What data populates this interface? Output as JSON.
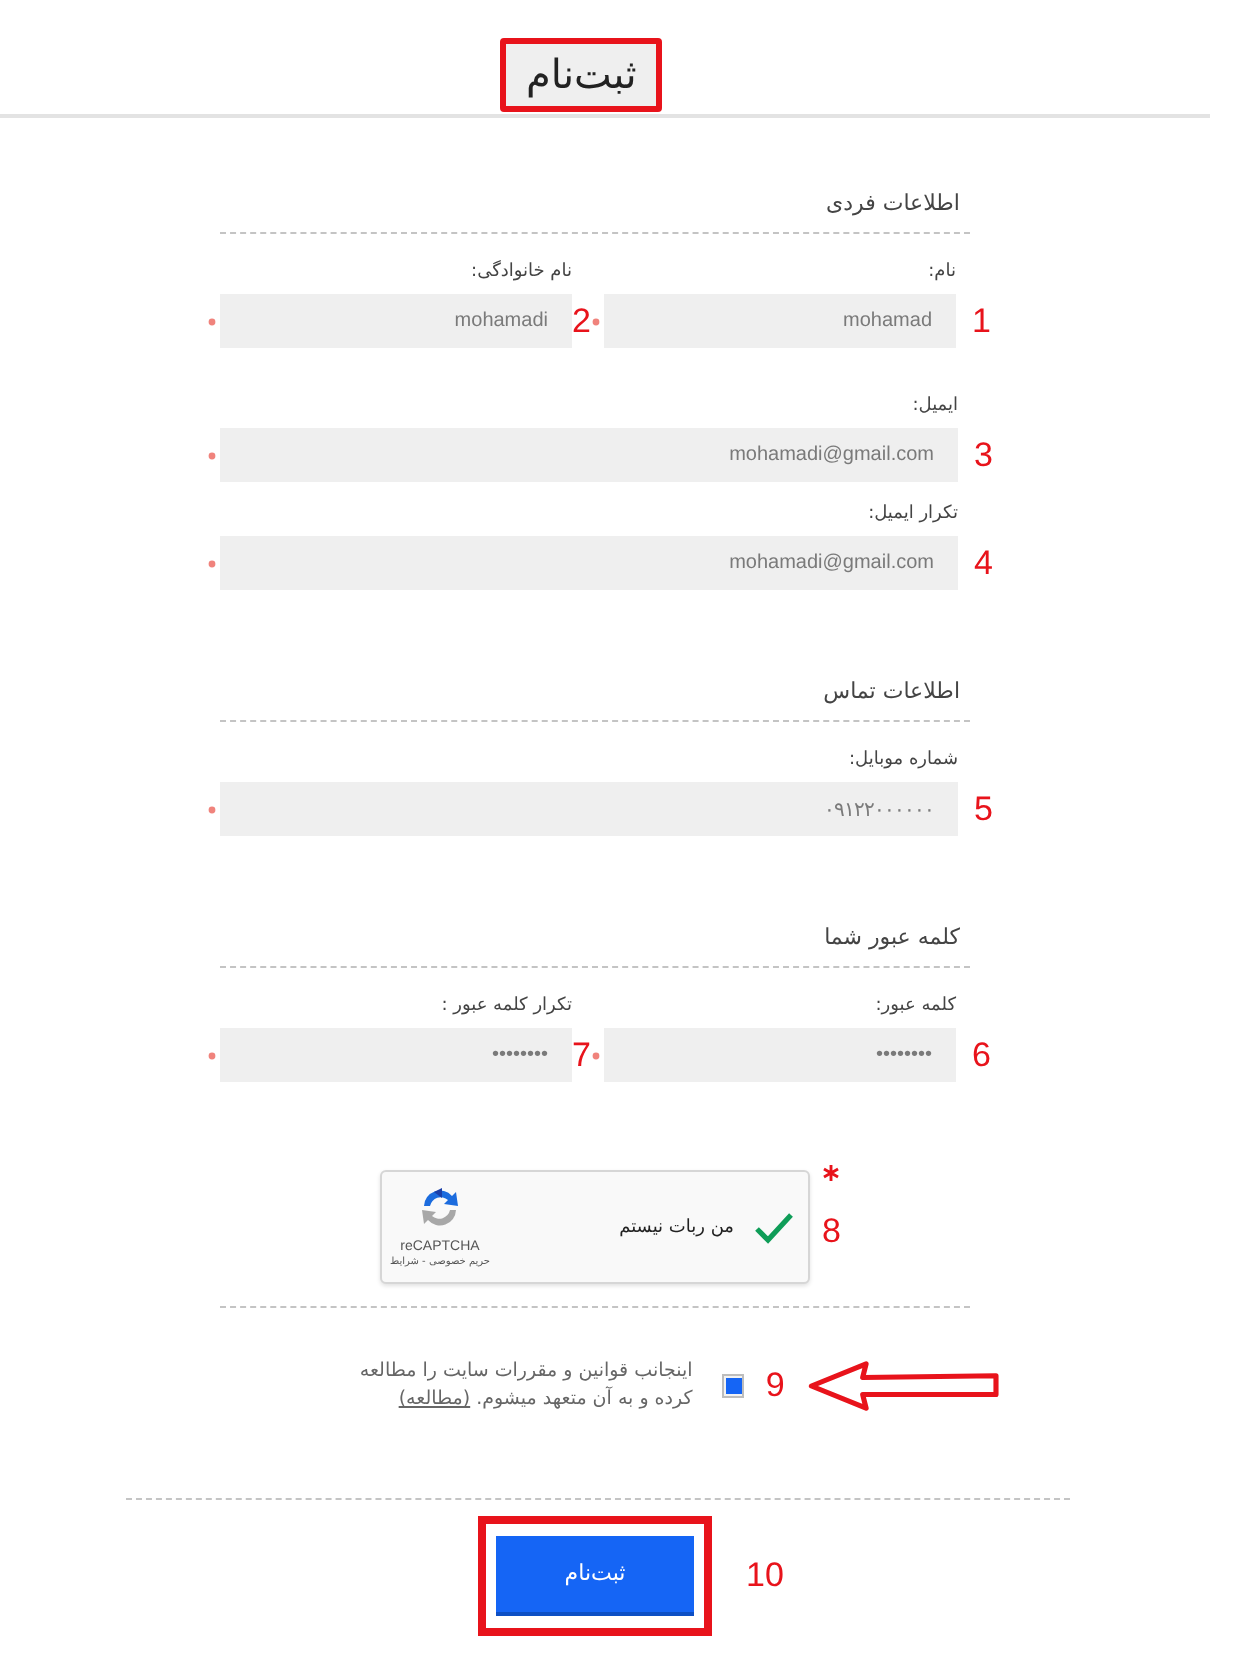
{
  "page_title": {
    "text": "ثبت‌نام",
    "highlighted": true
  },
  "sections": [
    {
      "heading": "اطلاعات فردی",
      "rows": [
        {
          "fields": [
            {
              "label": "نام:",
              "value": "mohamad",
              "required": true,
              "marker": "1"
            },
            {
              "label": "نام خانوادگی:",
              "value": "mohamadi",
              "required": true,
              "marker": "2"
            }
          ]
        },
        {
          "fields": [
            {
              "label": "ایمیل:",
              "value": "mohamadi@gmail.com",
              "required": true,
              "marker": "3"
            }
          ]
        },
        {
          "fields": [
            {
              "label": "تکرار ایمیل:",
              "value": "mohamadi@gmail.com",
              "required": true,
              "marker": "4"
            }
          ]
        }
      ]
    },
    {
      "heading": "اطلاعات تماس",
      "rows": [
        {
          "fields": [
            {
              "label": "شماره موبایل:",
              "value": "۰۹۱۲۲۰۰۰۰۰۰",
              "required": true,
              "marker": "5"
            }
          ]
        }
      ]
    },
    {
      "heading": "کلمه عبور شما",
      "rows": [
        {
          "fields": [
            {
              "label": "کلمه عبور:",
              "value": "••••••••",
              "required": true,
              "marker": "6"
            },
            {
              "label": "تکرار کلمه عبور :",
              "value": "••••••••",
              "required": true,
              "marker": "7"
            }
          ]
        }
      ]
    }
  ],
  "captcha": {
    "label": "من ربات نیستم",
    "checked": true,
    "brand": "reCAPTCHA",
    "links": "حریم خصوصی - شرایط",
    "required": true,
    "marker": "8"
  },
  "terms": {
    "checked": true,
    "text": "اینجانب قوانین و مقررات سایت را مطالعه کرده و به آن متعهد میشوم.",
    "link": "(مطالعه)",
    "marker": "9",
    "pointer_arrow": true
  },
  "submit": {
    "label": "ثبت‌نام",
    "highlighted": true,
    "marker": "10"
  }
}
